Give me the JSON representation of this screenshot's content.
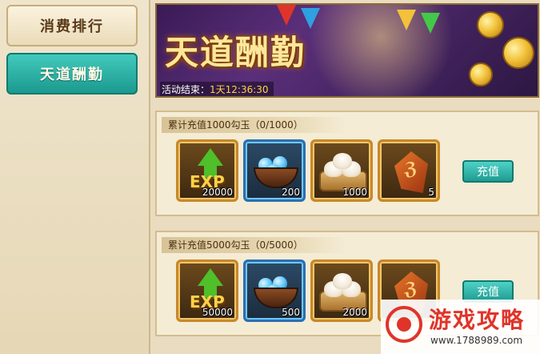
{
  "sidebar": {
    "tabs": [
      {
        "label": "消费排行",
        "active": false
      },
      {
        "label": "天道酬勤",
        "active": true
      }
    ]
  },
  "banner": {
    "title": "天道酬勤",
    "timer_label": "活动结束：",
    "timer_value": "1天12:36:30"
  },
  "rewards": [
    {
      "header": "累计充值1000勾玉（0/1000）",
      "button": "充值",
      "items": [
        {
          "icon": "exp-icon",
          "qty": "20000"
        },
        {
          "icon": "blue-pearl-bowl-icon",
          "qty": "200"
        },
        {
          "icon": "steamed-bun-icon",
          "qty": "1000"
        },
        {
          "icon": "rune-stone-icon",
          "qty": "5"
        }
      ]
    },
    {
      "header": "累计充值5000勾玉（0/5000）",
      "button": "充值",
      "items": [
        {
          "icon": "exp-icon",
          "qty": "50000"
        },
        {
          "icon": "blue-pearl-bowl-icon",
          "qty": "500"
        },
        {
          "icon": "steamed-bun-icon",
          "qty": "2000"
        },
        {
          "icon": "rune-stone-icon",
          "qty": ""
        }
      ]
    }
  ],
  "watermark": {
    "text": "游戏攻略",
    "url": "www.1788989.com"
  },
  "colors": {
    "accent_teal": "#1b9a8f",
    "gold": "#ffd24a",
    "banner_purple": "#3a1a55"
  }
}
